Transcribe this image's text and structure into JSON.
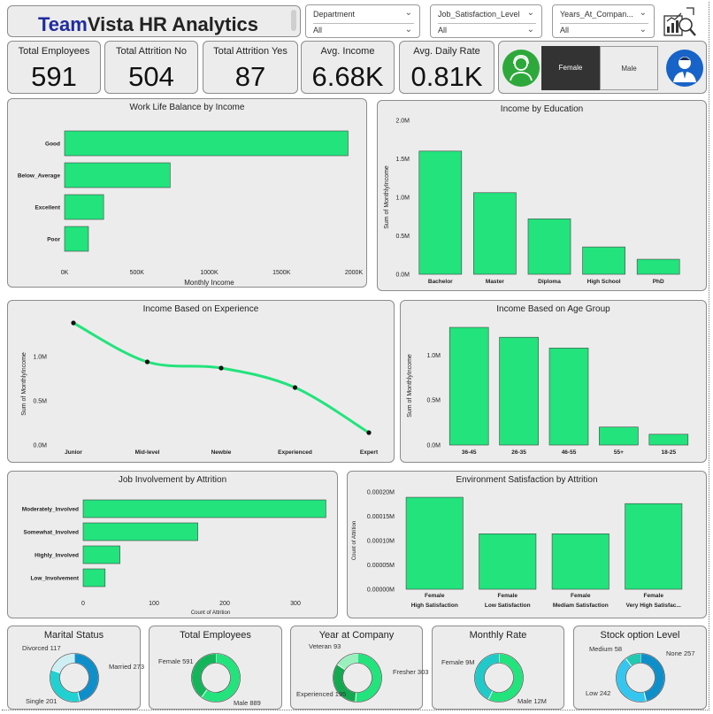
{
  "header": {
    "title_part1": "Team",
    "title_part2": "Vista HR Analytics"
  },
  "slicers": [
    {
      "label": "Department",
      "value": "All"
    },
    {
      "label": "Job_Satisfaction_Level",
      "value": "All"
    },
    {
      "label": "Years_At_Compan...",
      "value": "All"
    }
  ],
  "kpis": [
    {
      "label": "Total Employees",
      "value": "591"
    },
    {
      "label": "Total Attrition No",
      "value": "504"
    },
    {
      "label": "Total Attrition Yes",
      "value": "87"
    },
    {
      "label": "Avg. Income",
      "value": "6.68K"
    },
    {
      "label": "Avg. Daily Rate",
      "value": "0.81K"
    }
  ],
  "gender": {
    "female": "Female",
    "male": "Male",
    "selected": "Female"
  },
  "colors": {
    "bar": "#22e37c",
    "dark_blue": "#0f5fa8",
    "teal": "#21c9c9",
    "green_icon": "#2ea83a",
    "blue_icon": "#1763c7"
  },
  "charts": {
    "wlb": {
      "title": "Work Life Balance by Income",
      "xlabel": "Monthly Income",
      "ticks": [
        "0K",
        "500K",
        "1000K",
        "1500K",
        "2000K"
      ]
    },
    "edu": {
      "title": "Income by Education",
      "ylabel": "Sum of MonthlyIncome",
      "ticks": [
        "0.0M",
        "0.5M",
        "1.0M",
        "1.5M",
        "2.0M"
      ]
    },
    "exp": {
      "title": "Income Based on Experience",
      "ylabel": "Sum of MonthlyIncome",
      "ticks": [
        "0.0M",
        "0.5M",
        "1.0M"
      ]
    },
    "age": {
      "title": "Income Based on Age Group",
      "ylabel": "Sum of MonthlyIncome",
      "ticks": [
        "0.0M",
        "0.5M",
        "1.0M"
      ]
    },
    "job": {
      "title": "Job Involvement by Attrition",
      "xlabel": "Count of Attrition",
      "ticks": [
        "0",
        "100",
        "200",
        "300"
      ]
    },
    "env": {
      "title": "Environment Satisfaction by Attrition",
      "ylabel": "Count of Attrition",
      "ticks": [
        "0.00000M",
        "0.00005M",
        "0.00010M",
        "0.00015M",
        "0.00020M"
      ]
    }
  },
  "chart_data": [
    {
      "type": "bar",
      "orientation": "horizontal",
      "title": "Work Life Balance by Income",
      "xlabel": "Monthly Income",
      "ylabel": "",
      "categories": [
        "Good",
        "Below_Average",
        "Excellent",
        "Poor"
      ],
      "values": [
        1960000,
        730000,
        270000,
        165000
      ],
      "xlim": [
        0,
        2000000
      ]
    },
    {
      "type": "bar",
      "title": "Income by Education",
      "xlabel": "",
      "ylabel": "Sum of MonthlyIncome",
      "categories": [
        "Bachelor",
        "Master",
        "Diploma",
        "High School",
        "PhD"
      ],
      "values": [
        1600000,
        1060000,
        720000,
        355000,
        195000
      ],
      "ylim": [
        0,
        2000000
      ]
    },
    {
      "type": "line",
      "title": "Income Based on Experience",
      "xlabel": "",
      "ylabel": "Sum of MonthlyIncome",
      "categories": [
        "Junior",
        "Mid-level",
        "Newbie",
        "Experienced",
        "Expert"
      ],
      "values": [
        1380000,
        940000,
        870000,
        650000,
        140000
      ],
      "ylim": [
        0,
        1380000
      ]
    },
    {
      "type": "bar",
      "title": "Income Based on Age Group",
      "xlabel": "",
      "ylabel": "Sum of MonthlyIncome",
      "categories": [
        "36-45",
        "26-35",
        "46-55",
        "55+",
        "18-25"
      ],
      "values": [
        1310000,
        1200000,
        1080000,
        200000,
        120000
      ],
      "ylim": [
        0,
        1320000
      ]
    },
    {
      "type": "bar",
      "orientation": "horizontal",
      "title": "Job Involvement by Attrition",
      "xlabel": "Count of Attrition",
      "ylabel": "",
      "categories": [
        "Moderately_Involved",
        "Somewhat_Involved",
        "Highly_Involved",
        "Low_Involvement"
      ],
      "values": [
        343,
        162,
        52,
        31
      ],
      "xlim": [
        0,
        360
      ]
    },
    {
      "type": "bar",
      "title": "Environment Satisfaction by Attrition",
      "xlabel": "",
      "ylabel": "Count of Attrition",
      "categories": [
        [
          "Female",
          "High Satisfaction"
        ],
        [
          "Female",
          "Low Satisfaction"
        ],
        [
          "Female",
          "Mediam Satisfaction"
        ],
        [
          "Female",
          "Very High Satisfac..."
        ]
      ],
      "values": [
        0.000189,
        0.000114,
        0.000114,
        0.000176
      ],
      "ylim": [
        0,
        0.0002
      ]
    },
    {
      "type": "pie",
      "donut": true,
      "title": "Marital Status",
      "labels": [
        "Married",
        "Single",
        "Divorced"
      ],
      "values": [
        273,
        201,
        117
      ],
      "display": [
        "Married\n273",
        "Single 201",
        "Divorced\n117"
      ],
      "colors": [
        "#0f8fc9",
        "#21d1d1",
        "#cdeef3"
      ]
    },
    {
      "type": "pie",
      "donut": true,
      "title": "Total Employees",
      "labels": [
        "Male",
        "Female"
      ],
      "values": [
        889,
        591
      ],
      "display": [
        "Male 889",
        "Female\n591"
      ],
      "colors": [
        "#22e37c",
        "#14b55a"
      ]
    },
    {
      "type": "pie",
      "donut": true,
      "title": "Year at Company",
      "labels": [
        "Fresher",
        "Experienced",
        "Veteran"
      ],
      "values": [
        303,
        195,
        93
      ],
      "display": [
        "Fresher\n303",
        "Experienced\n195",
        "Veteran 93"
      ],
      "colors": [
        "#22e37c",
        "#14a850",
        "#9af0bd"
      ]
    },
    {
      "type": "pie",
      "donut": true,
      "title": "Monthly Rate",
      "labels": [
        "Male",
        "Female"
      ],
      "values": [
        12,
        9
      ],
      "display": [
        "Male 12M",
        "Female\n9M"
      ],
      "colors": [
        "#22e37c",
        "#21c9c9"
      ]
    },
    {
      "type": "pie",
      "donut": true,
      "title": "Stock option Level",
      "labels": [
        "None",
        "Low",
        "Medium"
      ],
      "values": [
        257,
        242,
        58
      ],
      "display": [
        "None 257",
        "Low 242",
        "Medium\n58"
      ],
      "colors": [
        "#0f8fc9",
        "#35c6ef",
        "#21c9b0"
      ]
    }
  ]
}
